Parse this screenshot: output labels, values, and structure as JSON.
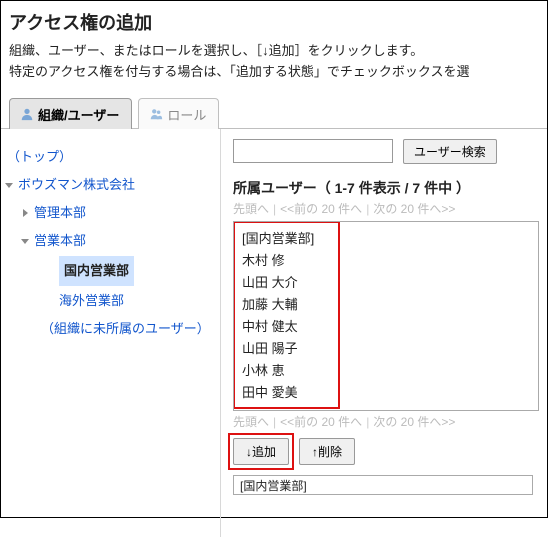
{
  "header": {
    "title": "アクセス権の追加",
    "desc1": "組織、ユーザー、またはロールを選択し、［↓追加］をクリックします。",
    "desc2": "特定のアクセス権を付与する場合は、「追加する状態」でチェックボックスを選"
  },
  "tabs": {
    "org_user": "組織/ユーザー",
    "role": "ロール"
  },
  "tree": {
    "top": "（トップ）",
    "company": "ボウズマン株式会社",
    "admin": "管理本部",
    "sales": "営業本部",
    "domestic": "国内営業部",
    "overseas": "海外営業部",
    "unassigned": "（組織に未所属のユーザー）"
  },
  "search": {
    "placeholder": "",
    "button": "ユーザー検索"
  },
  "members": {
    "title": "所属ユーザー（ 1-7 件表示 / 7 件中 ）",
    "pager_head": "先頭へ",
    "pager_prev": "<<前の 20 件へ",
    "pager_next": "次の 20 件へ>>",
    "group_header": "[国内営業部]",
    "list": [
      "木村 修",
      "山田 大介",
      "加藤 大輔",
      "中村 健太",
      "山田 陽子",
      "小林 恵",
      "田中 愛美"
    ]
  },
  "actions": {
    "add": "↓追加",
    "remove": "↑削除"
  },
  "stage": {
    "selected": "[国内営業部]"
  }
}
